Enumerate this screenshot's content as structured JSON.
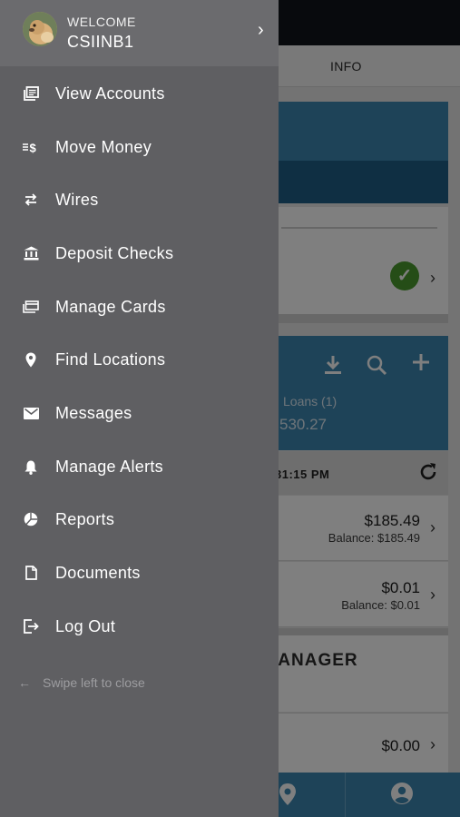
{
  "drawer": {
    "welcome_label": "WELCOME",
    "username": "CSIINB1",
    "menu": [
      {
        "label": "View Accounts",
        "icon": "accounts-icon"
      },
      {
        "label": "Move Money",
        "icon": "transfer-icon"
      },
      {
        "label": "Wires",
        "icon": "wire-icon"
      },
      {
        "label": "Deposit Checks",
        "icon": "bank-icon"
      },
      {
        "label": "Manage Cards",
        "icon": "cards-icon"
      },
      {
        "label": "Find Locations",
        "icon": "location-pin-icon"
      },
      {
        "label": "Messages",
        "icon": "envelope-icon"
      },
      {
        "label": "Manage Alerts",
        "icon": "bell-icon"
      },
      {
        "label": "Reports",
        "icon": "pie-chart-icon"
      },
      {
        "label": "Documents",
        "icon": "document-icon"
      },
      {
        "label": "Log Out",
        "icon": "logout-icon"
      }
    ],
    "swipe_hint": "Swipe left to close"
  },
  "background": {
    "tab_info": "INFO",
    "loans_label": "Loans (1)",
    "total_partial": "530.27",
    "time_partial": "31:15 PM",
    "rows": [
      {
        "amount": "$185.49",
        "balance": "Balance: $185.49"
      },
      {
        "amount": "$0.01",
        "balance": "Balance: $0.01"
      }
    ],
    "manager_partial": "IANAGER",
    "row3_amount": "$0.00"
  },
  "colors": {
    "drawer_bg": "#5f5f62",
    "drawer_header_bg": "#6b6b6e",
    "accent_blue": "#3d87b1",
    "success_green": "#4a9a2f"
  }
}
